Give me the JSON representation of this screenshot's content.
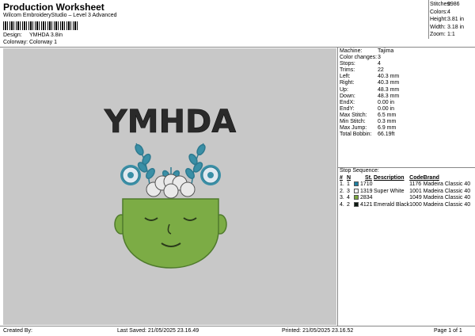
{
  "header": {
    "title": "Production Worksheet",
    "subtitle": "Wilcom EmbroideryStudio – Level 3 Advanced",
    "design_label": "Design:",
    "design_value": "YMHDA 3.8in",
    "colorway_label": "Colorway:",
    "colorway_value": "Colorway 1"
  },
  "stats": [
    {
      "k": "Stitches:",
      "v": "9986"
    },
    {
      "k": "Colors:",
      "v": "4"
    },
    {
      "k": "Height:",
      "v": "3.81 in"
    },
    {
      "k": "Width:",
      "v": "3.18 in"
    },
    {
      "k": "Zoom:",
      "v": "1:1"
    }
  ],
  "preview": {
    "design_text": "YMHDA",
    "colors": {
      "text": "#2a2a2a",
      "face": "#7cac45",
      "face_dark": "#4f7a2c",
      "leaf": "#3a8fa6",
      "flower": "#dfe9f0",
      "brain": "#e9e9e9",
      "bg": "#c8c8c8"
    }
  },
  "info": [
    {
      "k": "Machine:",
      "v": "Tajima"
    },
    {
      "k": "Color changes:",
      "v": "3"
    },
    {
      "k": "Stops:",
      "v": "4"
    },
    {
      "k": "Trims:",
      "v": "22"
    },
    {
      "k": "Left:",
      "v": "40.3 mm"
    },
    {
      "k": "Right:",
      "v": "40.3 mm"
    },
    {
      "k": "Up:",
      "v": "48.3 mm"
    },
    {
      "k": "Down:",
      "v": "48.3 mm"
    },
    {
      "k": "EndX:",
      "v": "0.00 in"
    },
    {
      "k": "EndY:",
      "v": "0.00 in"
    },
    {
      "k": "Max Stitch:",
      "v": "6.5 mm"
    },
    {
      "k": "Min Stitch:",
      "v": "0.3 mm"
    },
    {
      "k": "Max Jump:",
      "v": "6.9 mm"
    },
    {
      "k": "Total Bobbin:",
      "v": "66.19ft"
    }
  ],
  "sequence": {
    "title": "Stop Sequence:",
    "headers": [
      "#",
      "N",
      "St.",
      "Description",
      "Code",
      "Brand"
    ],
    "rows": [
      {
        "num": "1.",
        "n": "1",
        "color": "#1e7fa0",
        "st": "1710",
        "desc": "",
        "code": "1176",
        "brand": "Madeira Classic 40"
      },
      {
        "num": "2.",
        "n": "3",
        "color": "#f4f4f4",
        "st": "1319",
        "desc": "Super White",
        "code": "1001",
        "brand": "Madeira Classic 40"
      },
      {
        "num": "3.",
        "n": "4",
        "color": "#7aa83c",
        "st": "2834",
        "desc": "",
        "code": "1049",
        "brand": "Madeira Classic 40"
      },
      {
        "num": "4.",
        "n": "2",
        "color": "#0d1a12",
        "st": "4121",
        "desc": "Emerald Black",
        "code": "1000",
        "brand": "Madeira Classic 40"
      }
    ]
  },
  "footer": {
    "created": "Created By:",
    "saved": "Last Saved: 21/05/2025 23.16.49",
    "printed": "Printed: 21/05/2025 23.16.52",
    "page": "Page 1 of 1"
  }
}
